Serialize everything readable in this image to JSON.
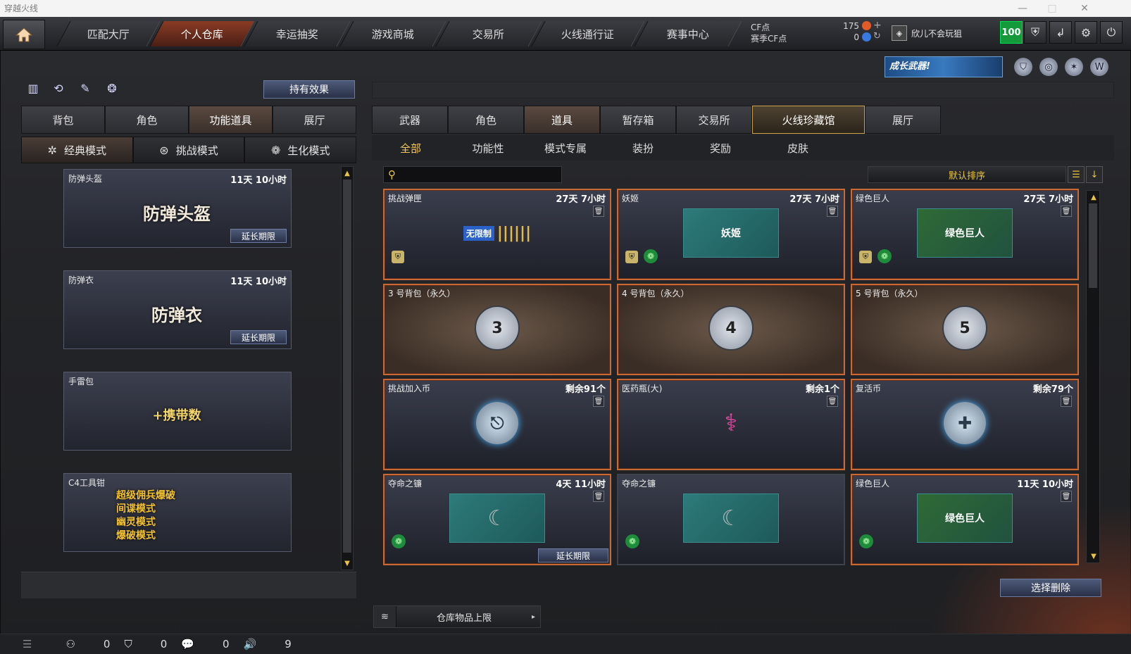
{
  "window": {
    "title": "穿越火线"
  },
  "nav": {
    "tabs": [
      "匹配大厅",
      "个人仓库",
      "幸运抽奖",
      "游戏商城",
      "交易所",
      "火线通行证",
      "赛事中心"
    ],
    "active_index": 1
  },
  "currency": {
    "cf_label": "CF点",
    "cf_value": "175",
    "season_label": "赛季CF点",
    "season_value": "0"
  },
  "user": {
    "name": "欣儿不会玩狙",
    "level": "100"
  },
  "banner": {
    "text": "成长武器!"
  },
  "left": {
    "effects_button": "持有效果",
    "tabs": [
      "背包",
      "角色",
      "功能道具",
      "展厅"
    ],
    "active_tab": 2,
    "modes": [
      {
        "label": "经典模式",
        "icon": "✲"
      },
      {
        "label": "挑战模式",
        "icon": "⊛"
      },
      {
        "label": "生化模式",
        "icon": "❁"
      }
    ],
    "items": [
      {
        "name": "防弹头盔",
        "time": "11天 10小时",
        "pic": "防弹头盔",
        "extend": "延长期限"
      },
      {
        "name": "防弹衣",
        "time": "11天 10小时",
        "pic": "防弹衣",
        "extend": "延长期限"
      },
      {
        "name": "手雷包",
        "time": "",
        "pic": "+携带数",
        "extend": ""
      },
      {
        "name": "C4工具钳",
        "time": "",
        "pic": "超级佣兵爆破\n间谍模式\n幽灵模式\n爆破模式",
        "extend": ""
      }
    ]
  },
  "right": {
    "tabs": [
      "武器",
      "角色",
      "道具",
      "暂存箱",
      "交易所",
      "火线珍藏馆",
      "展厅"
    ],
    "active_tab": 2,
    "highlight_tab": 5,
    "subtabs": [
      "全部",
      "功能性",
      "模式专属",
      "装扮",
      "奖励",
      "皮肤"
    ],
    "active_subtab": 0,
    "search_placeholder": "",
    "sort_label": "默认排序",
    "items": [
      {
        "name": "挑战弹匣",
        "time": "27天 7小时",
        "pic": "无限制"
      },
      {
        "name": "妖姬",
        "time": "27天 7小时",
        "pic": "妖姬"
      },
      {
        "name": "绿色巨人",
        "time": "27天 7小时",
        "pic": "绿色巨人"
      },
      {
        "name": "3 号背包（永久）",
        "time": "",
        "pic": "3"
      },
      {
        "name": "4 号背包（永久）",
        "time": "",
        "pic": "4"
      },
      {
        "name": "5 号背包（永久）",
        "time": "",
        "pic": "5"
      },
      {
        "name": "挑战加入币",
        "time": "剩余91个",
        "pic": ""
      },
      {
        "name": "医药瓶(大)",
        "time": "剩余1个",
        "pic": ""
      },
      {
        "name": "复活币",
        "time": "剩余79个",
        "pic": ""
      },
      {
        "name": "夺命之镰",
        "time": "4天 11小时",
        "pic": "",
        "extend": "延长期限"
      },
      {
        "name": "夺命之镰",
        "time": "",
        "pic": ""
      },
      {
        "name": "绿色巨人",
        "time": "11天 10小时",
        "pic": "绿色巨人"
      }
    ],
    "delete_button": "选择删除",
    "capacity_label": "仓库物品上限"
  },
  "status": {
    "a": "0",
    "b": "0",
    "c": "0",
    "d": "9"
  }
}
